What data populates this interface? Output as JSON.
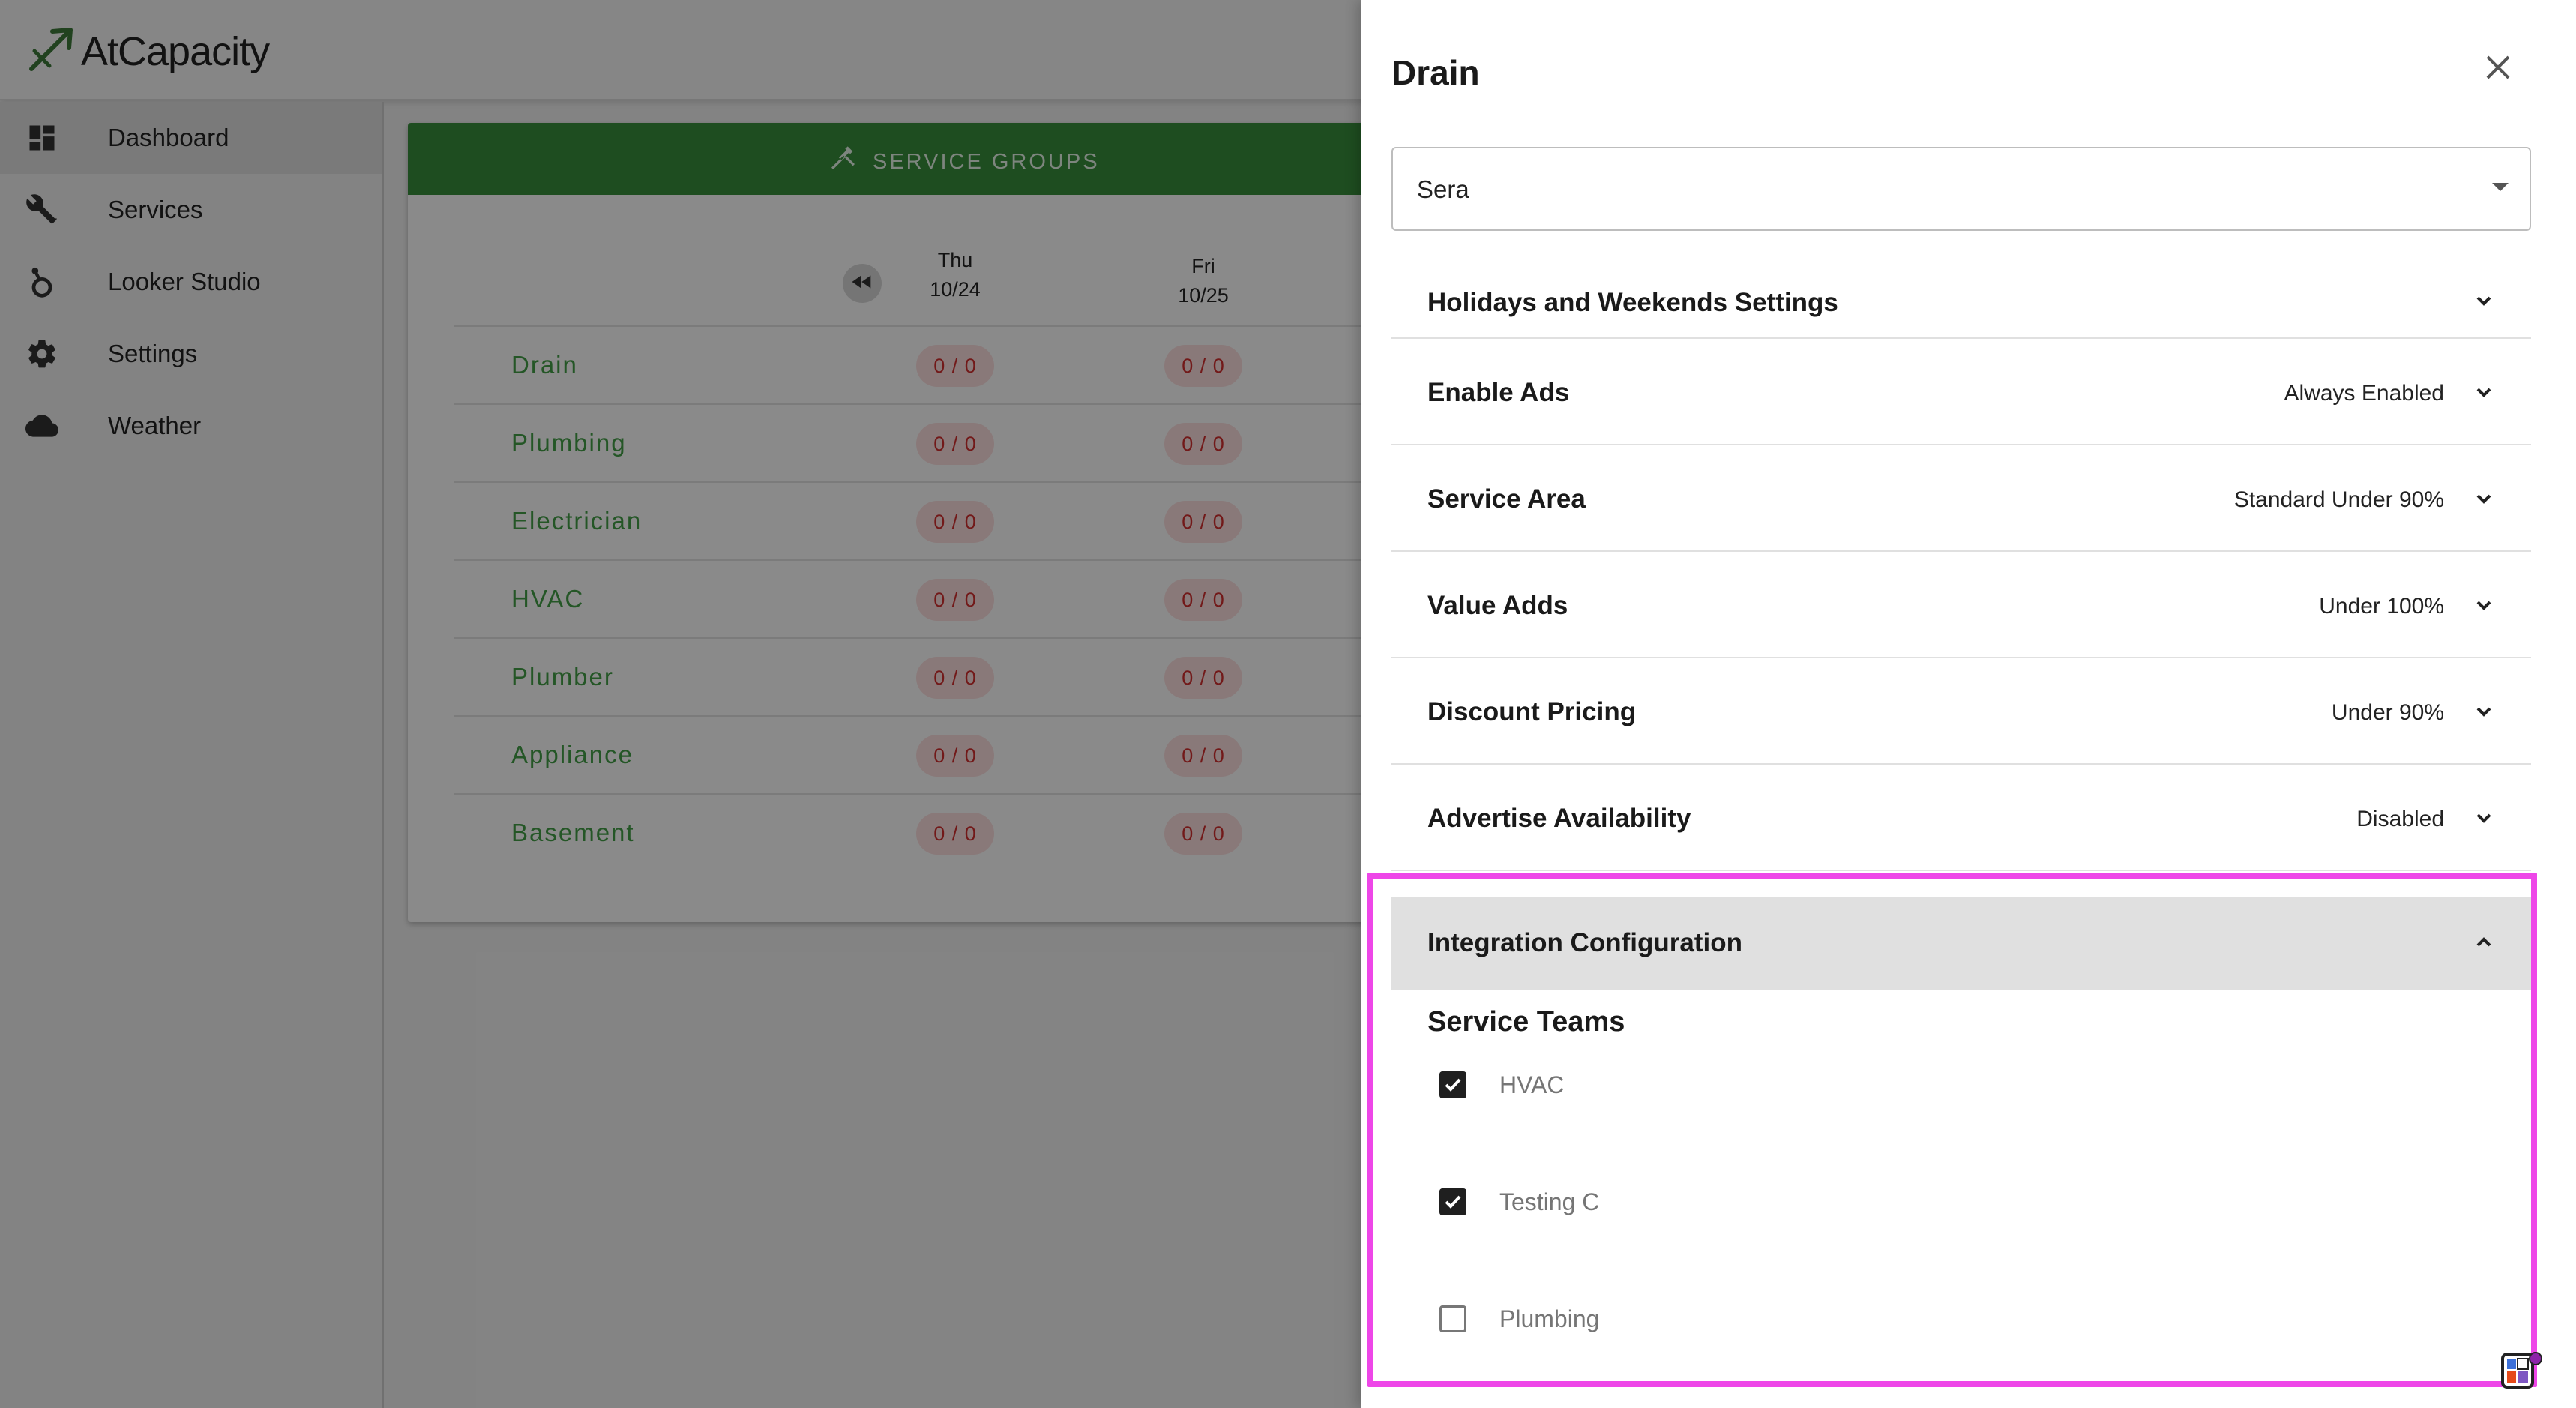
{
  "app": {
    "brand": "AtCapacity",
    "logo_icon": "arrow-logo-icon"
  },
  "sidebar": {
    "items": [
      {
        "label": "Dashboard",
        "icon": "dashboard-icon",
        "active": true
      },
      {
        "label": "Services",
        "icon": "tools-icon",
        "active": false
      },
      {
        "label": "Looker Studio",
        "icon": "looker-studio-icon",
        "active": false
      },
      {
        "label": "Settings",
        "icon": "gear-icon",
        "active": false
      },
      {
        "label": "Weather",
        "icon": "cloud-icon",
        "active": false
      }
    ]
  },
  "main": {
    "header_label": "SERVICE GROUPS",
    "days": [
      {
        "name": "Thu",
        "date": "10/24"
      },
      {
        "name": "Fri",
        "date": "10/25"
      }
    ],
    "services": [
      {
        "name": "Drain",
        "values": [
          "0 / 0",
          "0 / 0"
        ]
      },
      {
        "name": "Plumbing",
        "values": [
          "0 / 0",
          "0 / 0"
        ]
      },
      {
        "name": "Electrician",
        "values": [
          "0 / 0",
          "0 / 0"
        ]
      },
      {
        "name": "HVAC",
        "values": [
          "0 / 0",
          "0 / 0"
        ]
      },
      {
        "name": "Plumber",
        "values": [
          "0 / 0",
          "0 / 0"
        ]
      },
      {
        "name": "Appliance",
        "values": [
          "0 / 0",
          "0 / 0"
        ]
      },
      {
        "name": "Basement",
        "values": [
          "0 / 0",
          "0 / 0"
        ]
      }
    ]
  },
  "drawer": {
    "title": "Drain",
    "select_value": "Sera",
    "sections": [
      {
        "title": "Holidays and Weekends Settings",
        "value": ""
      },
      {
        "title": "Enable Ads",
        "value": "Always Enabled"
      },
      {
        "title": "Service Area",
        "value": "Standard Under 90%"
      },
      {
        "title": "Value Adds",
        "value": "Under 100%"
      },
      {
        "title": "Discount Pricing",
        "value": "Under 90%"
      },
      {
        "title": "Advertise Availability",
        "value": "Disabled"
      }
    ],
    "integration": {
      "title": "Integration Configuration",
      "expanded": true,
      "teams_heading": "Service Teams",
      "teams": [
        {
          "label": "HVAC",
          "checked": true
        },
        {
          "label": "Testing C",
          "checked": true
        },
        {
          "label": "Plumbing",
          "checked": false
        }
      ]
    }
  },
  "colors": {
    "brand_green": "#388e3c",
    "service_text_green": "#43a047",
    "pill_bg": "#fde0e0",
    "pill_text": "#d32f2f",
    "highlight": "#ee46e8"
  }
}
